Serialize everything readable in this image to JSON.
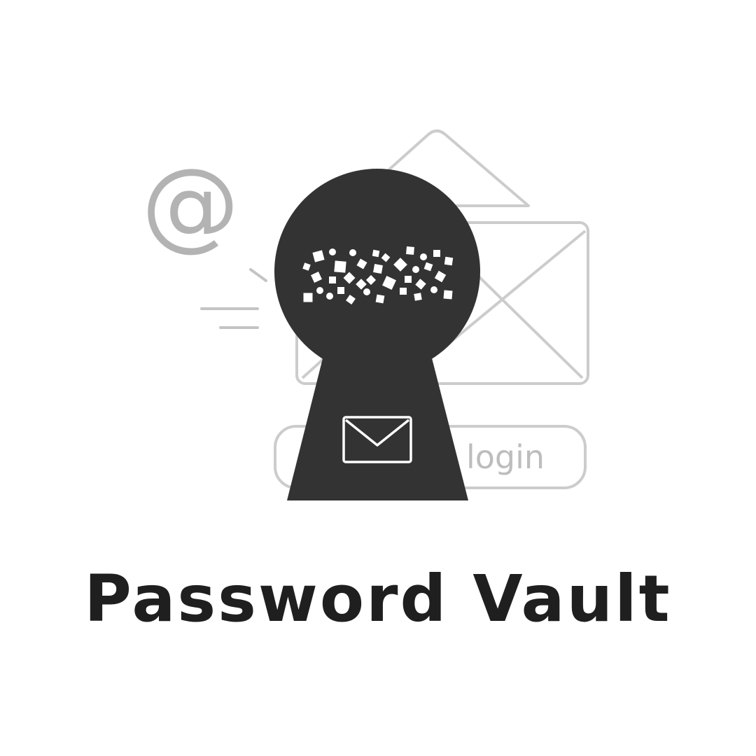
{
  "illustration": {
    "at_symbol": "@",
    "login_field_text": "login",
    "icons": [
      "at-sign-icon",
      "envelope-icon",
      "keyhole-icon",
      "envelope-icon",
      "login-field-icon"
    ],
    "colors": {
      "background": "#ffffff",
      "keyhole": "#333333",
      "line_art": "#cccccc",
      "at_symbol": "#b3b3b3",
      "login_text": "#bdbdbd",
      "title": "#1f1f1f"
    }
  },
  "title": "Password Vault"
}
